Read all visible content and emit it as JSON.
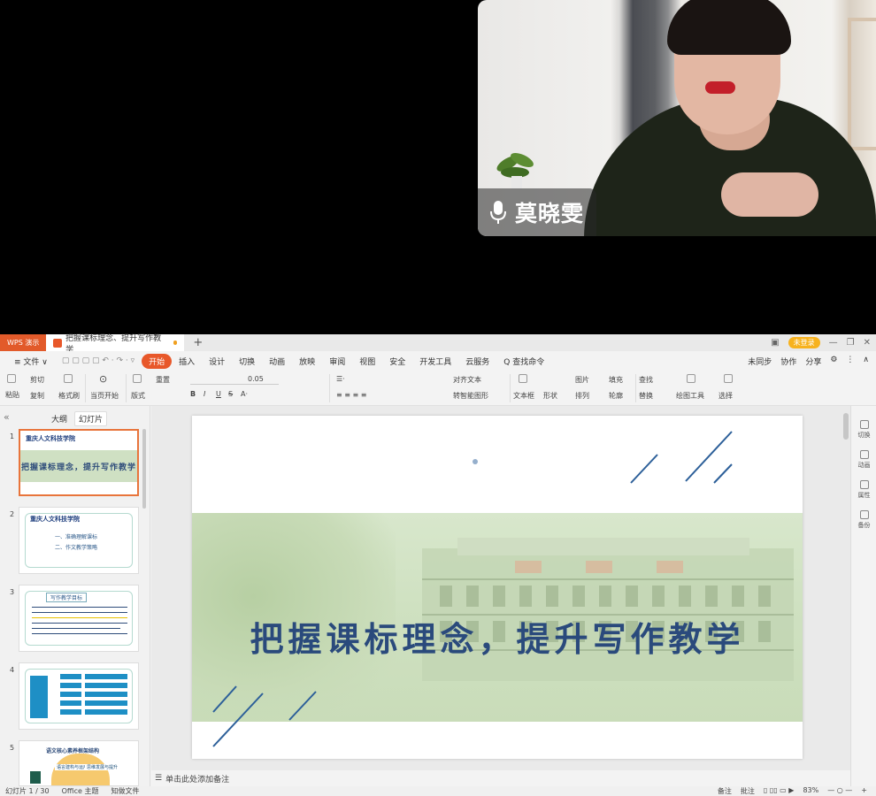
{
  "video": {
    "participant_name": "莫晓雯",
    "mic_icon": "microphone-icon"
  },
  "titlebar": {
    "app_name": "WPS 演示",
    "doc_title": "把握课标理念、提升写作教学",
    "new_tab": "+",
    "login": "未登录"
  },
  "menubar": {
    "items": [
      "≡ 文件 ∨",
      "开始",
      "插入",
      "设计",
      "切换",
      "动画",
      "放映",
      "审阅",
      "视图",
      "安全",
      "开发工具",
      "云服务",
      "Q 查找命令"
    ],
    "right": [
      "未同步",
      "协作",
      "分享"
    ]
  },
  "ribbon": {
    "paste": "粘贴",
    "cut": "剪切",
    "copy": "复制",
    "format_painter": "格式刷",
    "from_start": "当页开始",
    "new_slide": "版式",
    "reset": "重置",
    "font_size": "0.05",
    "text_box": "文本框",
    "shape": "形状",
    "arrange": "排列",
    "picture": "图片",
    "fill": "填充",
    "outline": "轮廓",
    "find": "查找",
    "replace": "替换",
    "drawing_tools": "绘图工具",
    "select": "选择",
    "text_align": "对齐文本",
    "smartart": "转智能图形"
  },
  "left_panel": {
    "tab_outline": "大纲",
    "tab_slides": "幻灯片",
    "thumbnails": [
      {
        "num": "1",
        "title": "把握课标理念，提升写作教学",
        "logo": "重庆人文科技学院"
      },
      {
        "num": "2",
        "logo": "重庆人文科技学院",
        "items": [
          "一、准确理解课标",
          "二、作文教学策略"
        ]
      },
      {
        "num": "3",
        "heading": "写作教学目标"
      },
      {
        "num": "4"
      },
      {
        "num": "5",
        "heading": "语文核心素养框架结构",
        "items": [
          "语言建构与运用",
          "思维发展与提升"
        ]
      }
    ]
  },
  "slide": {
    "title": "把握课标理念，提升写作教学"
  },
  "right_strip": {
    "items": [
      "切换",
      "动画",
      "属性",
      "备份"
    ]
  },
  "notes": {
    "placeholder": "单击此处添加备注"
  },
  "status": {
    "slide_count": "幻灯片 1 / 30",
    "theme": "Office 主题",
    "backup": "知做文件",
    "notes": "备注",
    "comments": "批注",
    "zoom": "83%"
  }
}
